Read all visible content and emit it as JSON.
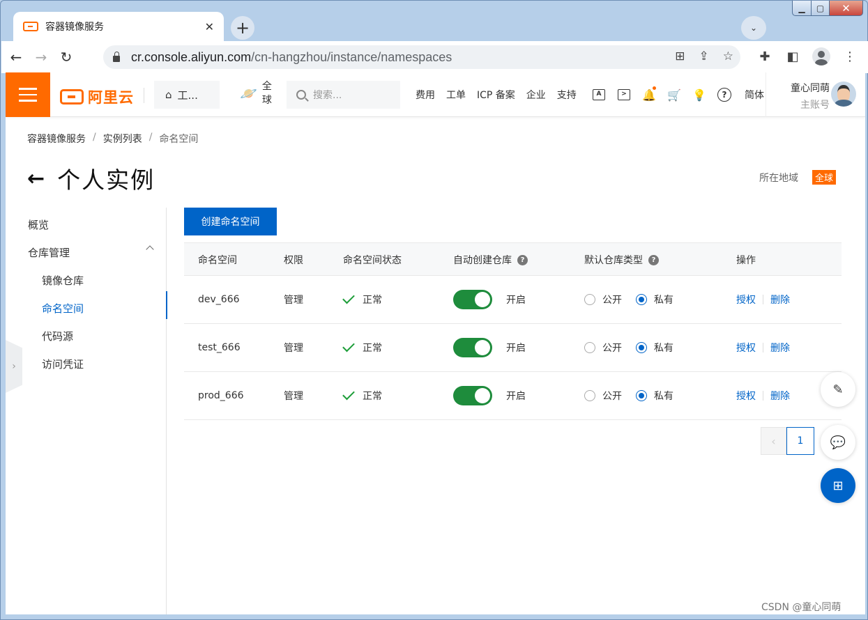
{
  "browser": {
    "tab_title": "容器镜像服务",
    "tab_close": "✕",
    "new_tab": "+",
    "url_host": "cr.console.aliyun.com",
    "url_path": "/cn-hangzhou/instance/namespaces"
  },
  "header": {
    "logo_text": "阿里云",
    "workbench_label": "工...",
    "region_selector": "全球",
    "search_placeholder": "搜索...",
    "links": [
      "费用",
      "工单",
      "ICP 备案",
      "企业",
      "支持"
    ],
    "language": "简体",
    "user_name": "童心同萌",
    "user_role": "主账号"
  },
  "breadcrumb": {
    "items": [
      "容器镜像服务",
      "实例列表",
      "命名空间"
    ],
    "separator": "/"
  },
  "page": {
    "title": "个人实例",
    "region_label": "所在地域",
    "region_value": "全球",
    "create_button": "创建命名空间"
  },
  "sidenav": {
    "overview": "概览",
    "repo_management": "仓库管理",
    "image_repos": "镜像仓库",
    "namespaces": "命名空间",
    "code_source": "代码源",
    "access_credentials": "访问凭证"
  },
  "table": {
    "columns": {
      "namespace": "命名空间",
      "permission": "权限",
      "status": "命名空间状态",
      "auto_create": "自动创建仓库",
      "default_type": "默认仓库类型",
      "actions": "操作"
    },
    "rows": [
      {
        "namespace": "dev_666",
        "permission": "管理",
        "status": "正常",
        "auto_create": "开启",
        "public_label": "公开",
        "private_label": "私有",
        "authorize": "授权",
        "delete": "删除"
      },
      {
        "namespace": "test_666",
        "permission": "管理",
        "status": "正常",
        "auto_create": "开启",
        "public_label": "公开",
        "private_label": "私有",
        "authorize": "授权",
        "delete": "删除"
      },
      {
        "namespace": "prod_666",
        "permission": "管理",
        "status": "正常",
        "auto_create": "开启",
        "public_label": "公开",
        "private_label": "私有",
        "authorize": "授权",
        "delete": "删除"
      }
    ]
  },
  "pagination": {
    "current_page": "1"
  },
  "watermark": "CSDN @童心同萌",
  "colors": {
    "brand_orange": "#ff6a00",
    "primary_blue": "#0064c8",
    "success_green": "#1e8c3c"
  }
}
